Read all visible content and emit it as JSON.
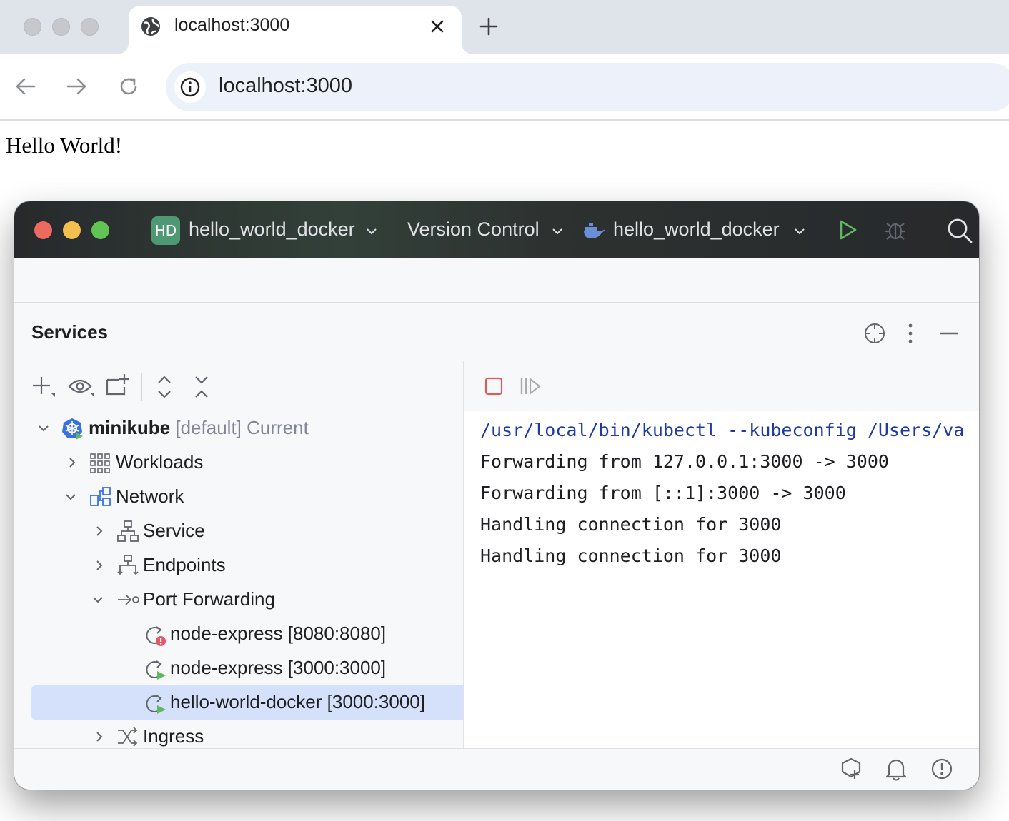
{
  "browser": {
    "tab_title": "localhost:3000",
    "url": "localhost:3000",
    "page_text": "Hello World!"
  },
  "ide": {
    "project_badge": "HD",
    "project_name": "hello_world_docker",
    "vcs_label": "Version Control",
    "run_config": "hello_world_docker",
    "services_title": "Services",
    "tree": {
      "cluster_name": "minikube",
      "cluster_meta": "[default] Current",
      "workloads": "Workloads",
      "network": "Network",
      "service": "Service",
      "endpoints": "Endpoints",
      "port_forwarding": "Port Forwarding",
      "pf_items": [
        {
          "label": "node-express [8080:8080]",
          "status": "error"
        },
        {
          "label": "node-express [3000:3000]",
          "status": "running"
        },
        {
          "label": "hello-world-docker [3000:3000]",
          "status": "running"
        }
      ],
      "ingress": "Ingress"
    },
    "console": [
      "/usr/local/bin/kubectl --kubeconfig /Users/va",
      "Forwarding from 127.0.0.1:3000 -> 3000",
      "Forwarding from [::1]:3000 -> 3000",
      "Handling connection for 3000",
      "Handling connection for 3000"
    ]
  },
  "colors": {
    "selection": "#d5e1fb",
    "run_green": "#5fb85f",
    "stop_red": "#db5c5c",
    "command_blue": "#1d3ba6",
    "project_badge": "#4f9874"
  }
}
